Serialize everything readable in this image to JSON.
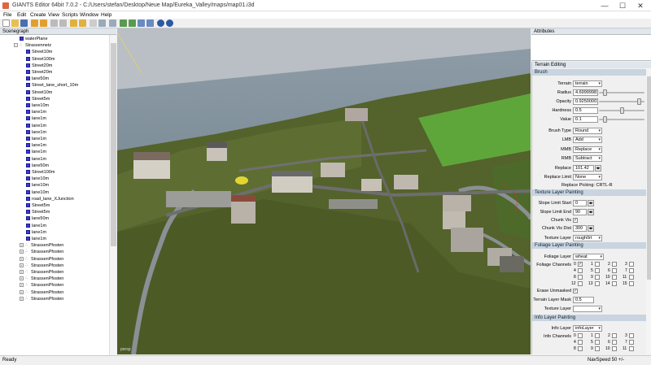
{
  "window": {
    "title": "GIANTS Editor 64bit 7.0.2 - C:/Users/stefan/Desktop/Neue Map/Eureka_Valley/maps/map01.i3d",
    "minimize": "—",
    "maximize": "☐",
    "close": "✕"
  },
  "menu": [
    "File",
    "Edit",
    "Create",
    "View",
    "Scripts",
    "Window",
    "Help"
  ],
  "scenegraph": {
    "header": "Scenegraph",
    "root": "waterPlane",
    "group": "Strassennetz",
    "items": [
      "Street10m",
      "Street100m",
      "Street20m",
      "Street20m",
      "lane50m",
      "Street_lane_short_10m",
      "Street10m",
      "Street5m",
      "lane10m",
      "lane1m",
      "lane1m",
      "lane1m",
      "lane1m",
      "lane1m",
      "lane1m",
      "lane1m",
      "lane1m",
      "lane50m",
      "Street100m",
      "lane10m",
      "lane10m",
      "lane10m",
      "road_lane_XJunction",
      "Street5m",
      "Street5m",
      "lane50m",
      "lane1m",
      "lane1m",
      "lane1m"
    ],
    "posts": [
      "StrassenPfosten",
      "StrassenPfosten",
      "StrassenPfosten",
      "StrassenPfosten",
      "StrassenPfosten",
      "StrassenPfosten",
      "StrassenPfosten",
      "StrassenPfosten",
      "StrassenPfosten"
    ]
  },
  "viewport": {
    "camera_label": "persp"
  },
  "attributes": {
    "header": "Attributes"
  },
  "terrain_editing": {
    "header": "Terrain Editing",
    "brush": {
      "section": "Brush",
      "terrain_label": "Terrain",
      "terrain_value": "terrain",
      "radius_label": "Radius",
      "radius_value": "4.69999981",
      "radius_level": 0.1,
      "opacity_label": "Opacity",
      "opacity_value": "0.92500001",
      "opacity_level": 0.925,
      "hardness_label": "Hardness",
      "hardness_value": "0.5",
      "hardness_level": 0.5,
      "value_label": "Value",
      "value_value": "0.1",
      "value_level": 0.1,
      "type_label": "Brush Type",
      "type_value": "Round",
      "lmb_label": "LMB",
      "lmb_value": "Add",
      "mmb_label": "MMB",
      "mmb_value": "Replace",
      "rmb_label": "RMB",
      "rmb_value": "Subtract",
      "replace_label": "Replace",
      "replace_value": "101.42",
      "replace_limit_label": "Replace Limit",
      "replace_limit_value": "None",
      "replace_picking": "Replace Picking: CRTL-R"
    },
    "texture": {
      "section": "Texture Layer Painting",
      "slope_start_label": "Slope Limit Start",
      "slope_start_value": "0",
      "slope_end_label": "Slope Limit End",
      "slope_end_value": "90",
      "chunk_vis_label": "Chunk Vis",
      "chunk_dist_label": "Chunk Vis Dist",
      "chunk_dist_value": "300",
      "layer_label": "Texture Layer",
      "layer_value": "rough0rt"
    },
    "foliage": {
      "section": "Foliage Layer Painting",
      "layer_label": "Foliage Layer",
      "layer_value": "wheat",
      "channels_label": "Foliage Channels",
      "channels": [
        "0",
        "1",
        "2",
        "3",
        "4",
        "5",
        "6",
        "7",
        "8",
        "9",
        "10",
        "11",
        "12",
        "13",
        "14",
        "15"
      ],
      "erase_label": "Erase Unmasked",
      "mask_label": "Terrain Layer Mask",
      "mask_value": "0.5",
      "tex_layer_label": "Texture Layer",
      "tex_layer_value": ""
    },
    "info": {
      "section": "Info Layer Painting",
      "layer_label": "Info Layer",
      "layer_value": "infoLayer",
      "channels_label": "Info Channels",
      "channels": [
        "0",
        "1",
        "2",
        "3",
        "4",
        "5",
        "6",
        "7",
        "8",
        "9",
        "10",
        "11"
      ]
    }
  },
  "status": {
    "left": "Ready",
    "right": "NavSpeed 50 +/-"
  }
}
